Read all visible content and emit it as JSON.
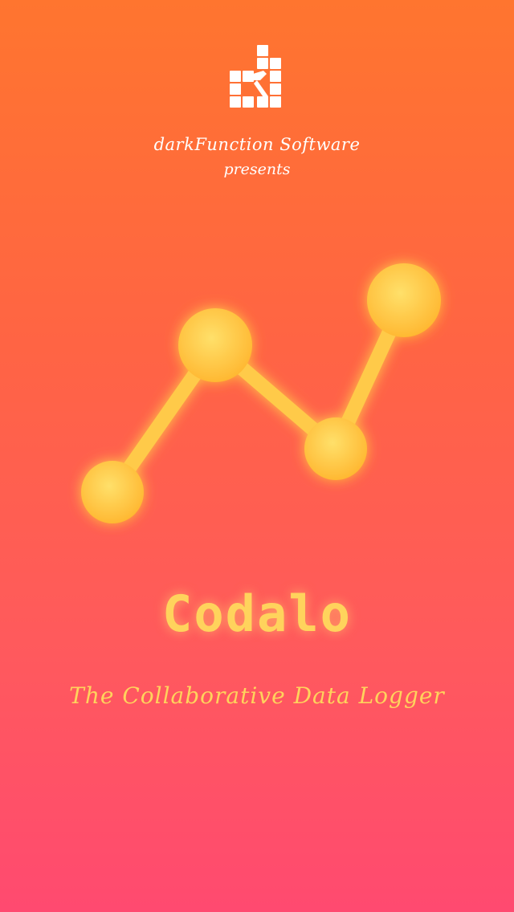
{
  "splash": {
    "company_name": "darkFunction Software",
    "presents_text": "presents",
    "app_name": "Codalo",
    "tagline": "The Collaborative Data Logger"
  },
  "colors": {
    "background_top": "#ff752f",
    "background_bottom": "#ff4a70",
    "accent_yellow": "#ffd35c",
    "node_light": "#ffe06a",
    "node_dark": "#ffb52e"
  },
  "icons": {
    "brand_logo": "grid-hammer-logo-icon",
    "app_mark": "line-graph-icon"
  },
  "graph_mark": {
    "nodes": 4
  }
}
